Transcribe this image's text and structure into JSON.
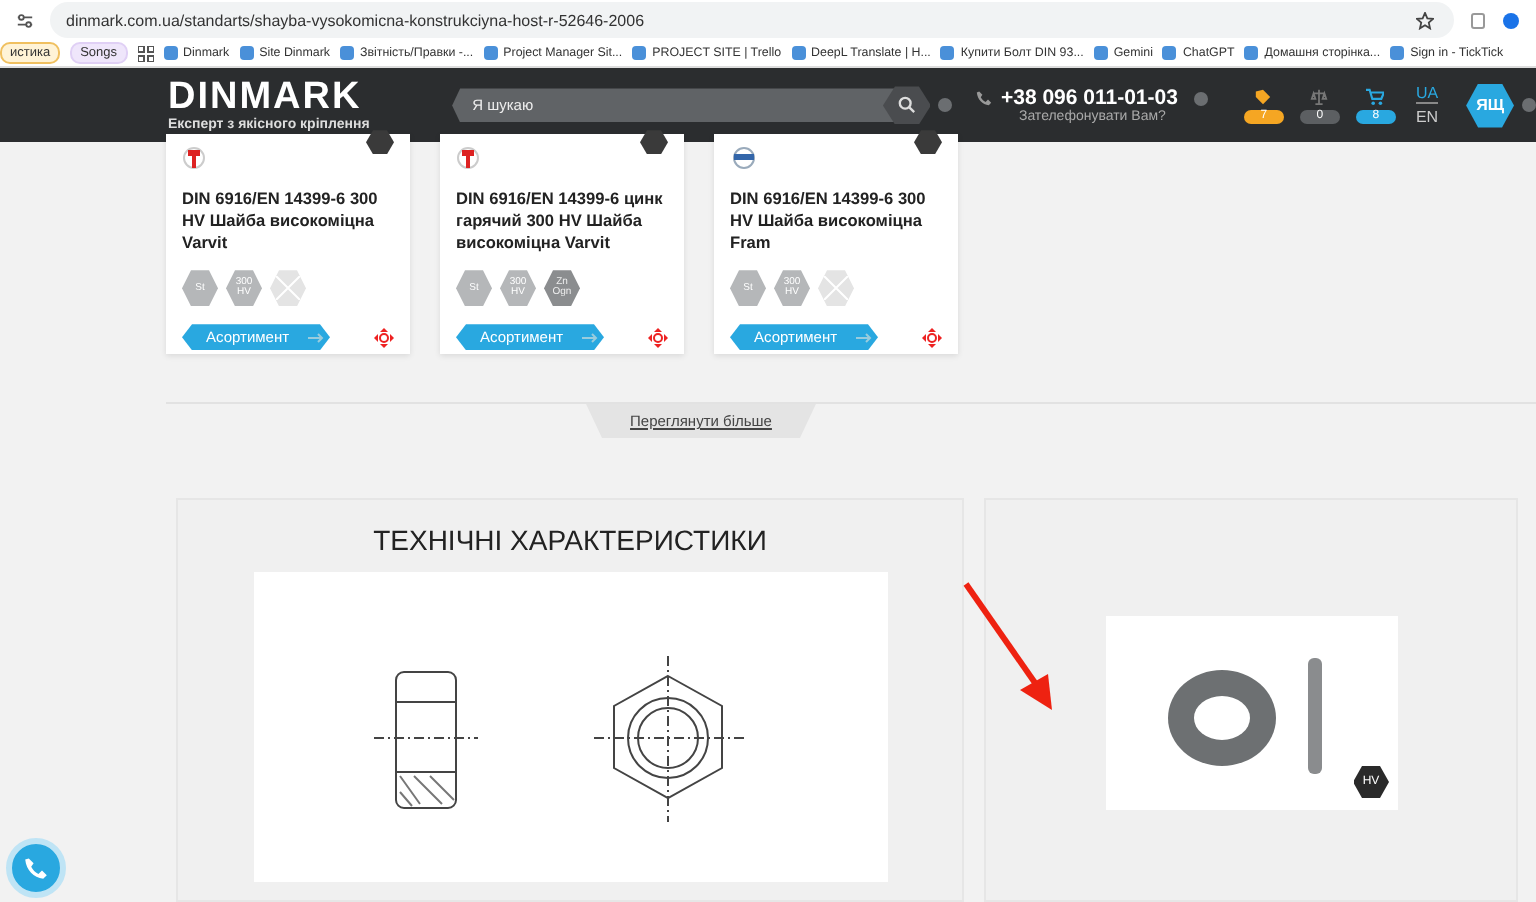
{
  "browser": {
    "url": "dinmark.com.ua/standarts/shayba-vysokomicna-konstrukciyna-host-r-52646-2006",
    "bookmarks": [
      {
        "label": "истика",
        "kind": "chip"
      },
      {
        "label": "Songs",
        "kind": "chip"
      },
      {
        "kind": "apps"
      },
      {
        "label": "Dinmark",
        "kind": "link"
      },
      {
        "label": "Site Dinmark",
        "kind": "link"
      },
      {
        "label": "Звітність/Правки -...",
        "kind": "link"
      },
      {
        "label": "Project Manager Sit...",
        "kind": "link"
      },
      {
        "label": "PROJECT SITE | Trello",
        "kind": "link"
      },
      {
        "label": "DeepL Translate | H...",
        "kind": "link"
      },
      {
        "label": "Купити Болт DIN 93...",
        "kind": "link"
      },
      {
        "label": "Gemini",
        "kind": "link"
      },
      {
        "label": "ChatGPT",
        "kind": "link"
      },
      {
        "label": "Домашня сторінка...",
        "kind": "link"
      },
      {
        "label": "Sign in - TickTick",
        "kind": "link"
      }
    ]
  },
  "header": {
    "logo": "DINMARK",
    "tagline": "Експерт з якісного кріплення",
    "search": {
      "placeholder": "Я шукаю"
    },
    "phone": "+38 096 011-01-03",
    "callback": "Зателефонувати Вам?",
    "counters": [
      {
        "kind": "favorites",
        "count": "7",
        "color": "#f5a623"
      },
      {
        "kind": "compare",
        "count": "0",
        "color": "#5c5f62"
      },
      {
        "kind": "cart",
        "count": "8",
        "color": "#29a8e0"
      }
    ],
    "languages": [
      {
        "label": "UA",
        "selected": true
      },
      {
        "label": "EN",
        "selected": false
      }
    ],
    "avatar": "ЯЩ"
  },
  "products": [
    {
      "kind": "varvit",
      "title": "DIN 6916/EN 14399-6 300 HV Шайба високоміцна Varvit",
      "badges": [
        {
          "kind": "label",
          "text": "St"
        },
        {
          "kind": "label",
          "text": "300 HV"
        },
        {
          "kind": "none"
        }
      ],
      "button": "Асортимент"
    },
    {
      "kind": "varvit",
      "title": "DIN 6916/EN 14399-6 цинк гарячий 300 HV Шайба високоміцна Varvit",
      "badges": [
        {
          "kind": "label",
          "text": "St"
        },
        {
          "kind": "label",
          "text": "300 HV"
        },
        {
          "kind": "dark",
          "text": "Zn Ogn"
        }
      ],
      "button": "Асортимент"
    },
    {
      "kind": "fram",
      "title": "DIN 6916/EN 14399-6 300 HV Шайба високоміцна Fram",
      "badges": [
        {
          "kind": "label",
          "text": "St"
        },
        {
          "kind": "label",
          "text": "300 HV"
        },
        {
          "kind": "none"
        }
      ],
      "button": "Асортимент"
    }
  ],
  "more_link": "Переглянути більше",
  "specs": {
    "title": "ТЕХНІЧНІ ХАРАКТЕРИСТИКИ"
  },
  "product_image": {
    "badge": "HV"
  }
}
